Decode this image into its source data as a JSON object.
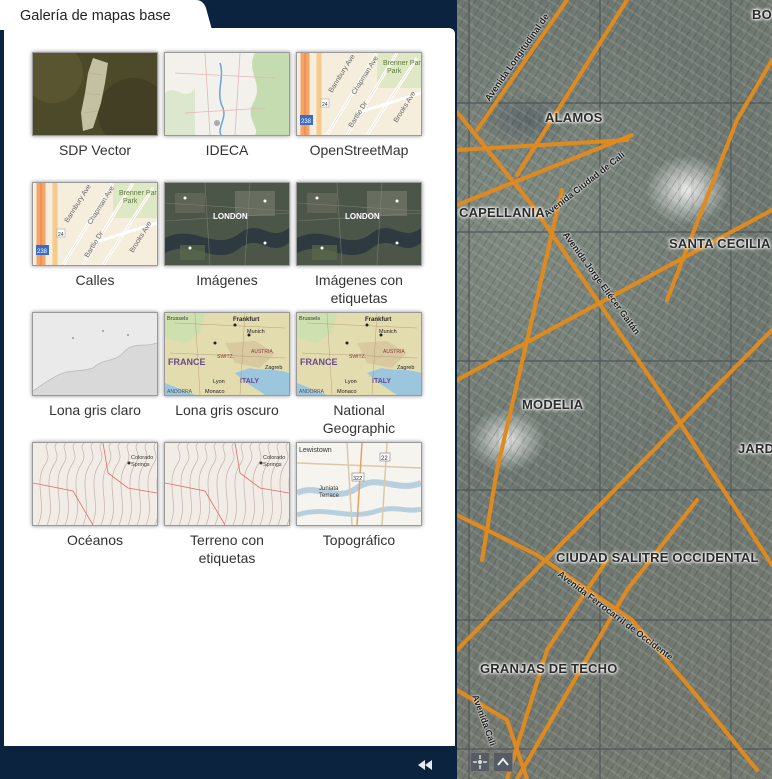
{
  "panel": {
    "title": "Galería de mapas base",
    "collapse_icon": "double-chevron-left-icon"
  },
  "basemaps": [
    {
      "id": "sdp",
      "label": "SDP Vector",
      "thumb": "satellite-dark"
    },
    {
      "id": "ideca",
      "label": "IDECA",
      "thumb": "light-topo"
    },
    {
      "id": "osm",
      "label": "OpenStreetMap",
      "thumb": "streets"
    },
    {
      "id": "streets",
      "label": "Calles",
      "thumb": "streets"
    },
    {
      "id": "imagery",
      "label": "Imágenes",
      "thumb": "imagery"
    },
    {
      "id": "imagery-labels",
      "label": "Imágenes con etiquetas",
      "thumb": "imagery"
    },
    {
      "id": "light-gray",
      "label": "Lona gris claro",
      "thumb": "gray"
    },
    {
      "id": "dark-gray",
      "label": "Lona gris oscuro",
      "thumb": "natgeo"
    },
    {
      "id": "natgeo",
      "label": "National Geographic",
      "thumb": "natgeo"
    },
    {
      "id": "oceans",
      "label": "Océanos",
      "thumb": "terrain"
    },
    {
      "id": "terrain-labels",
      "label": "Terreno con etiquetas",
      "thumb": "terrain"
    },
    {
      "id": "topo",
      "label": "Topográfico",
      "thumb": "topo"
    }
  ],
  "thumb_text": {
    "streets": [
      "Bannbury Ave",
      "Chapman Ave",
      "Brenner Park",
      "Bartlie Dr",
      "Brooks Ave",
      "Lac",
      "24",
      "238"
    ],
    "imagery": [
      "LONDON"
    ],
    "natgeo": [
      "Brussels",
      "Cologne",
      "Frankfurt",
      "Paris",
      "Stuttgart",
      "Munich",
      "FRANCE",
      "SWITZ.",
      "AUSTRIA",
      "Zagreb",
      "Lyon",
      "Milan",
      "ITALY",
      "Monaco",
      "CROATIA",
      "BOSN. & HERZ.",
      "ANDORRA"
    ],
    "terrain": [
      "Colorado Springs"
    ],
    "topo": [
      "Lewistown",
      "Juniata Terrace",
      "22",
      "322"
    ]
  },
  "map": {
    "labels": [
      "ALAMOS",
      "CAPELLANIA",
      "SANTA CECILIA",
      "MODELIA",
      "JARD",
      "CIUDAD SALITRE OCCIDENTAL",
      "GRANJAS DE TECHO",
      "BO"
    ],
    "roads": [
      "Avenida Longitudinal de",
      "Avenida Ciudad de Cali",
      "Avenida Jorge Eliécer Gaitán",
      "Avenida Ferrocarril de Occidente",
      "Avenida Cali"
    ]
  },
  "colors": {
    "panel_bg": "#0c2340",
    "road": "#e08a1e",
    "label_text": "#333333"
  }
}
